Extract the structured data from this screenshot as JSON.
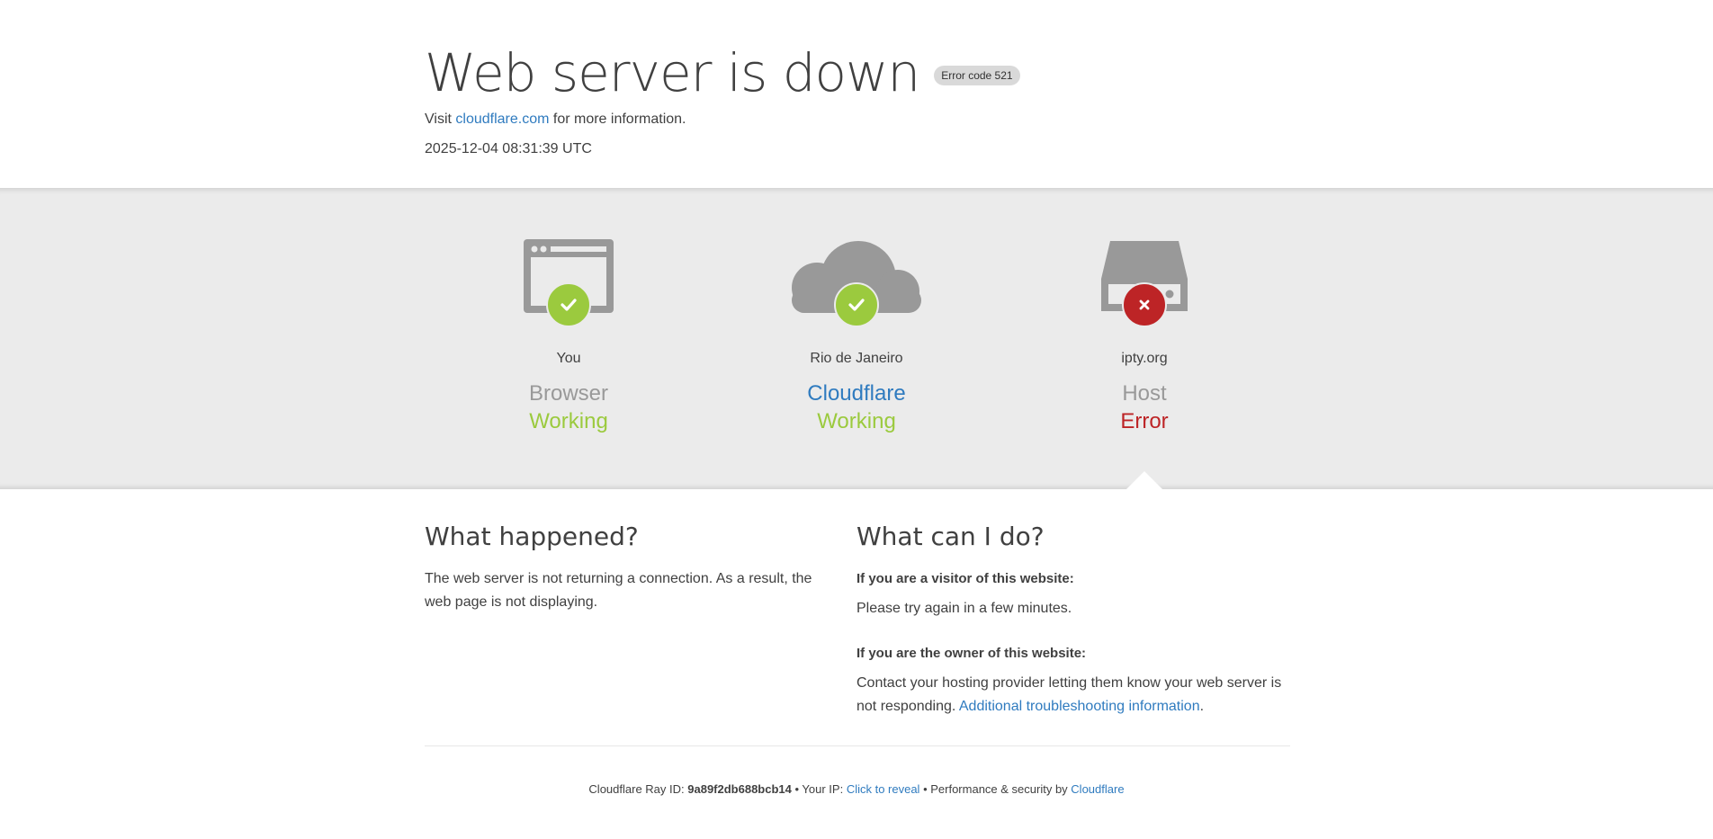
{
  "header": {
    "title": "Web server is down",
    "error_badge": "Error code 521",
    "visit_prefix": "Visit ",
    "visit_link": "cloudflare.com",
    "visit_suffix": " for more information.",
    "timestamp": "2025-12-04 08:31:39 UTC"
  },
  "status": {
    "nodes": [
      {
        "location": "You",
        "kind": "Browser",
        "state": "Working",
        "status": "ok",
        "icon": "browser-icon"
      },
      {
        "location": "Rio de Janeiro",
        "kind": "Cloudflare",
        "state": "Working",
        "status": "ok",
        "icon": "cloud-icon"
      },
      {
        "location": "ipty.org",
        "kind": "Host",
        "state": "Error",
        "status": "error",
        "icon": "server-icon"
      }
    ]
  },
  "what_happened": {
    "heading": "What happened?",
    "body": "The web server is not returning a connection. As a result, the web page is not displaying."
  },
  "what_can_i_do": {
    "heading": "What can I do?",
    "visitor_heading": "If you are a visitor of this website:",
    "visitor_body": "Please try again in a few minutes.",
    "owner_heading": "If you are the owner of this website:",
    "owner_body": "Contact your hosting provider letting them know your web server is not responding. ",
    "owner_link": "Additional troubleshooting information",
    "owner_suffix": "."
  },
  "footer": {
    "ray_label": "Cloudflare Ray ID: ",
    "ray_id": "9a89f2db688bcb14",
    "sep1": " • ",
    "ip_label": "Your IP: ",
    "ip_link": "Click to reveal",
    "sep2": " • ",
    "perf_label": "Performance & security by ",
    "perf_link": "Cloudflare"
  },
  "colors": {
    "ok": "#9bca3e",
    "error": "#bd2426",
    "link": "#2f7bbf",
    "band": "#ebebeb"
  }
}
